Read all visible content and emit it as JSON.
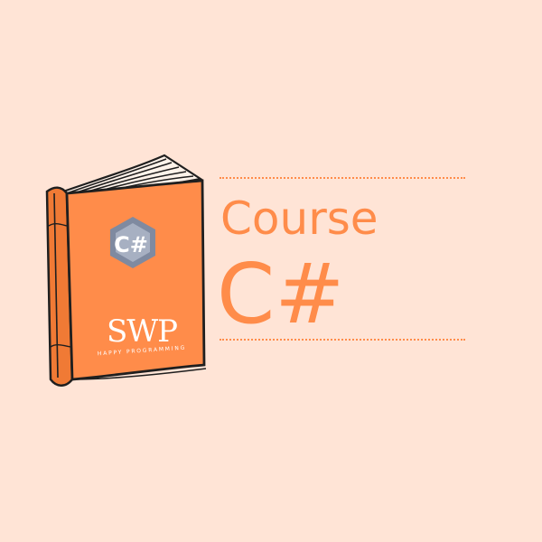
{
  "colors": {
    "background": "#ffe4d6",
    "accent": "#ff8c4a",
    "book_cover": "#ff8c4a",
    "book_spine": "#f07a35",
    "outline": "#1f1f1f",
    "pages": "#fff3ea",
    "hex_logo": "#a7b0c2",
    "hex_logo_dark": "#7f8aa0",
    "brand_text": "#ffffff"
  },
  "book": {
    "language_logo_text": "C#",
    "brand_logo_text": "SWP",
    "brand_tagline": "HAPPY PROGRAMMING"
  },
  "title": {
    "line1": "Course",
    "line2": "C#"
  },
  "icons": {
    "book": "book-illustration",
    "language_logo": "csharp-hexagon-icon"
  }
}
